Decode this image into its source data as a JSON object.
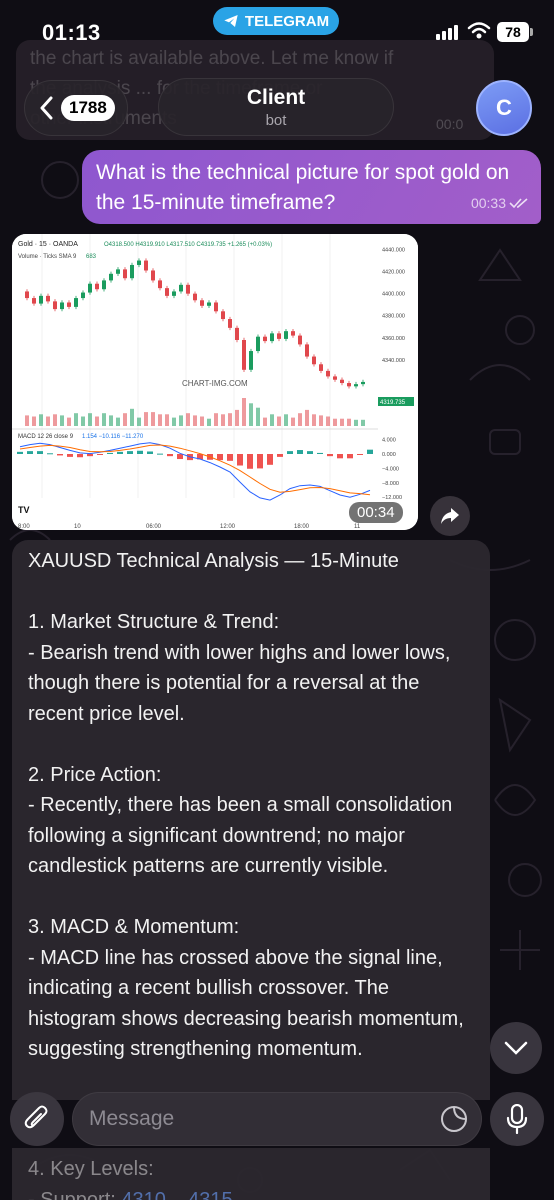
{
  "status_bar": {
    "time": "01:13",
    "app_pill": "TELEGRAM",
    "battery": "78"
  },
  "ghost_message": {
    "lines": [
      "the chart is available above. Let me know if",
      "the analysis ... for the timeframe or",
      "other instruments"
    ],
    "time": "00:0"
  },
  "header": {
    "unread_count": "1788",
    "chat_name": "Client",
    "chat_status": "bot",
    "avatar_letter": "C"
  },
  "outgoing": {
    "text": "What is the technical picture for spot gold on the 15-minute timeframe?",
    "time": "00:33"
  },
  "chart_message": {
    "time": "00:34",
    "chart_data": {
      "type": "line",
      "title": "Gold · 15 · OANDA",
      "ohlc_text": "O4318.500 H4319.910 L4317.510 C4319.735 +1.265 (+0.03%)",
      "volume_label": "Volume · Ticks SMA 9",
      "volume_value": "683",
      "watermark": "CHART-IMG.COM",
      "price_axis": [
        "4440.000",
        "4420.000",
        "4400.000",
        "4380.000",
        "4360.000",
        "4340.000"
      ],
      "last_price": "4319.735",
      "macd_label": "MACD 12 26 close 9",
      "macd_values": "1.154  −10.116  −11.270",
      "macd_axis": [
        "4.000",
        "0.000",
        "−4.000",
        "−8.000",
        "−12.000"
      ],
      "x_ticks": [
        "8:00",
        "10",
        "06:00",
        "12:00",
        "18:00",
        "11"
      ],
      "ylim": [
        4300,
        4445
      ],
      "series": [
        {
          "values": [
            4402,
            4396,
            4391,
            4398,
            4393,
            4386,
            4392,
            4388,
            4396,
            4401,
            4409,
            4404,
            4412,
            4418,
            4422,
            4414,
            4426,
            4430,
            4421,
            4412,
            4405,
            4398,
            4402,
            4408,
            4400,
            4394,
            4389,
            4392,
            4384,
            4377,
            4369,
            4358,
            4331,
            4348,
            4361,
            4357,
            4364,
            4359,
            4366,
            4362,
            4354,
            4343,
            4336,
            4330,
            4325,
            4322,
            4319,
            4316,
            4318,
            4320
          ]
        }
      ],
      "macd": {
        "macd_line": [
          2.0,
          2.6,
          3.0,
          2.6,
          1.8,
          1.0,
          0.3,
          0.1,
          0.5,
          1.0,
          1.6,
          2.2,
          2.8,
          3.1,
          2.6,
          1.6,
          0.2,
          -0.8,
          -1.4,
          -2.4,
          -3.6,
          -5.0,
          -7.8,
          -10.5,
          -12.2,
          -12.8,
          -11.4,
          -9.6,
          -8.8,
          -8.6,
          -9.0,
          -10.2,
          -11.4,
          -12.0,
          -11.2,
          -10.1
        ],
        "signal_line": [
          1.4,
          1.8,
          2.2,
          2.4,
          2.2,
          1.8,
          1.2,
          0.7,
          0.6,
          0.7,
          1.0,
          1.4,
          1.9,
          2.4,
          2.5,
          2.2,
          1.6,
          0.9,
          0.1,
          -0.8,
          -1.9,
          -3.1,
          -4.6,
          -6.4,
          -8.2,
          -9.8,
          -10.6,
          -10.4,
          -9.9,
          -9.4,
          -9.3,
          -9.6,
          -10.2,
          -10.8,
          -11.0,
          -11.3
        ]
      }
    }
  },
  "analysis": {
    "title": "XAUUSD Technical Analysis — 15-Minute",
    "s1_head": "1. Market Structure & Trend:",
    "s1_body": "- Bearish trend with lower highs and lower lows, though there is potential for a reversal at the recent price level.",
    "s2_head": "2. Price Action:",
    "s2_body": "- Recently, there has been a small consolidation following a significant downtrend; no major candlestick patterns are currently visible.",
    "s3_head": "3. MACD & Momentum:",
    "s3_body": "- MACD line has crossed above the signal line, indicating a recent bullish crossover. The histogram shows decreasing bearish momentum, suggesting strengthening momentum.",
    "s4_head": "4. Key Levels:",
    "s4_support_label": "- Support:",
    "s4_support_value": "4310 – 4315"
  },
  "input": {
    "placeholder": "Message"
  }
}
